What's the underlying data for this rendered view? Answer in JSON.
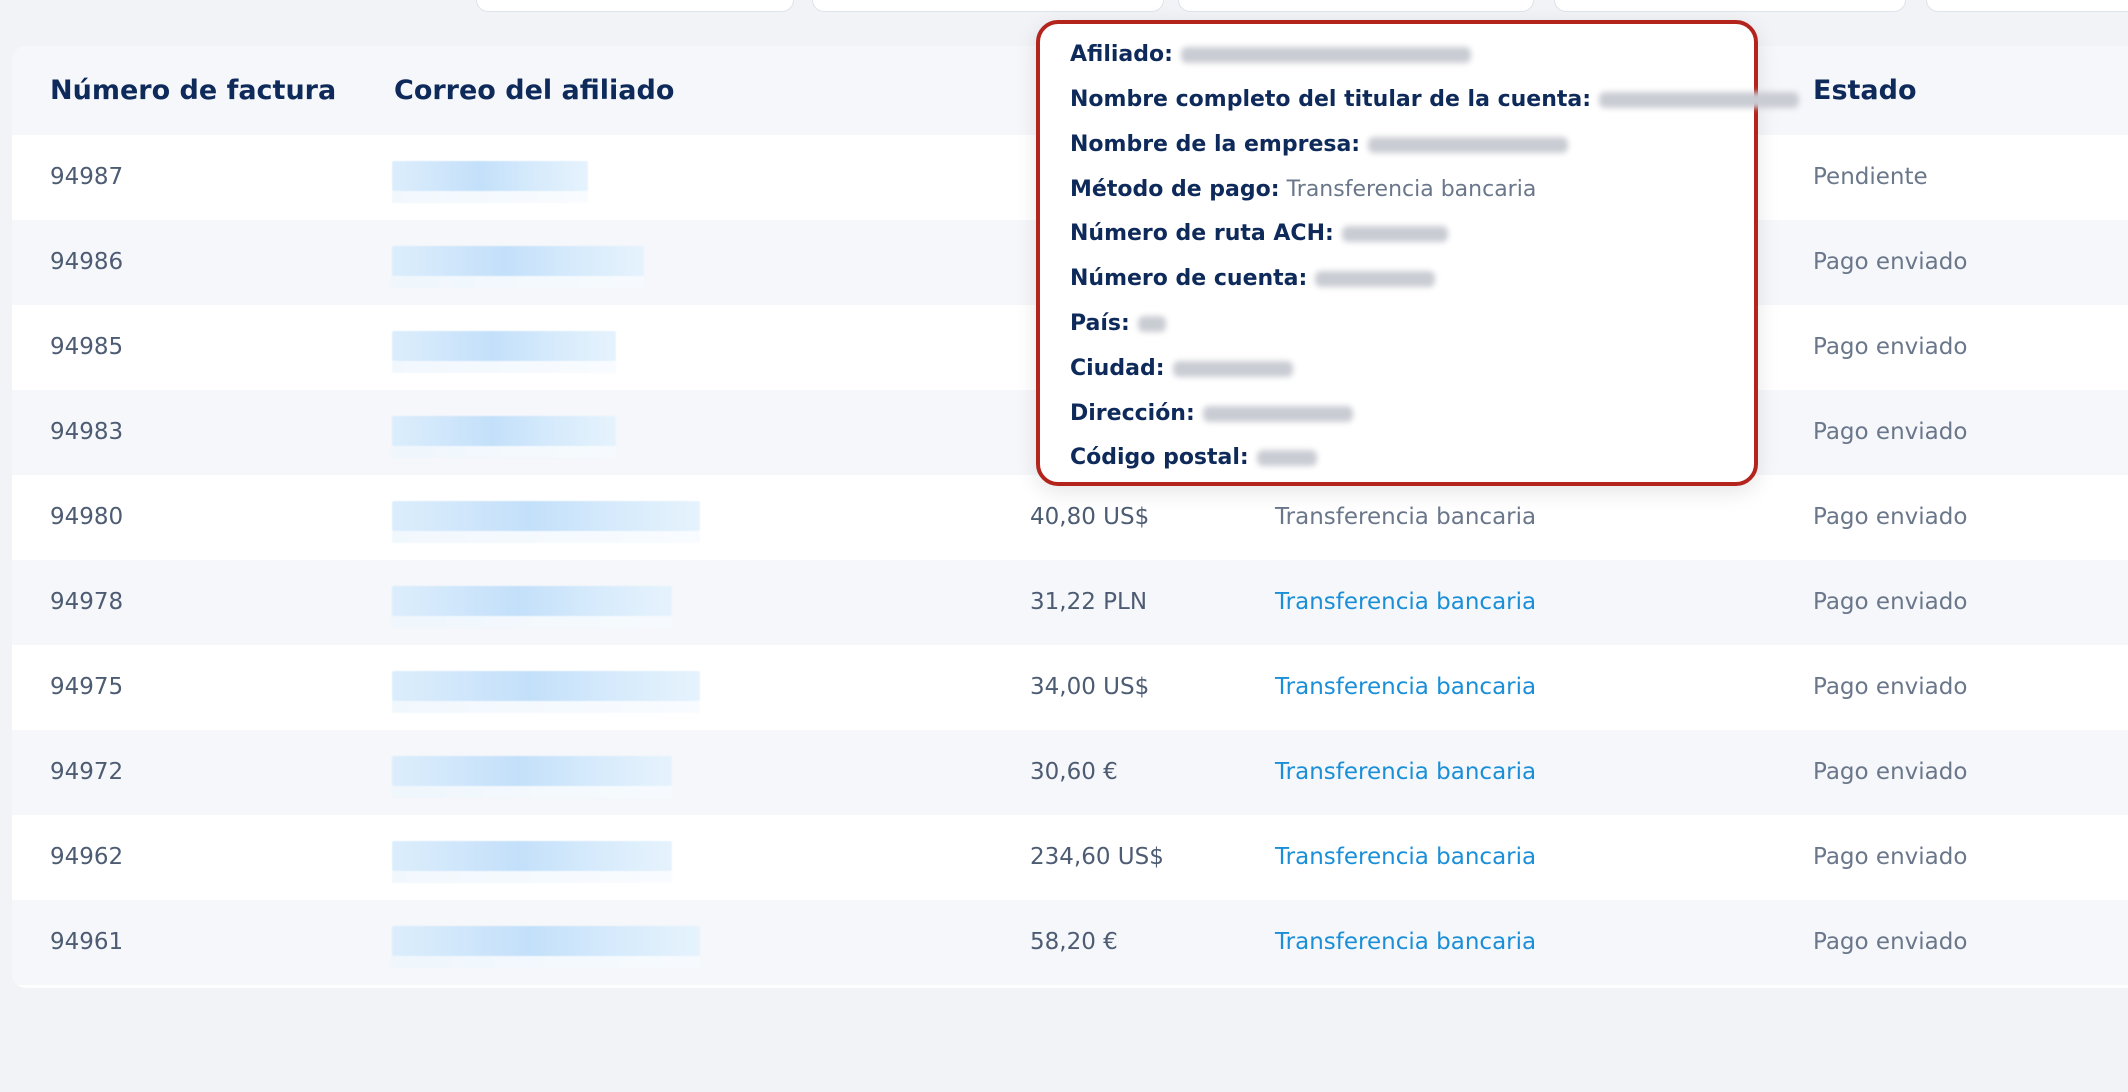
{
  "headers": {
    "invoice": "Número de factura",
    "email": "Correo del afiliado",
    "status": "Estado"
  },
  "rows": [
    {
      "invoice": "94987",
      "amount": "",
      "method": "",
      "status": "Pendiente"
    },
    {
      "invoice": "94986",
      "amount": "",
      "method": "",
      "status": "Pago enviado"
    },
    {
      "invoice": "94985",
      "amount": "",
      "method": "",
      "status": "Pago enviado"
    },
    {
      "invoice": "94983",
      "amount": "",
      "method": "",
      "status": "Pago enviado"
    },
    {
      "invoice": "94980",
      "amount": "40,80 US$",
      "method": "Transferencia bancaria",
      "status": "Pago enviado"
    },
    {
      "invoice": "94978",
      "amount": "31,22 PLN",
      "method": "Transferencia bancaria",
      "status": "Pago enviado"
    },
    {
      "invoice": "94975",
      "amount": "34,00 US$",
      "method": "Transferencia bancaria",
      "status": "Pago enviado"
    },
    {
      "invoice": "94972",
      "amount": "30,60 €",
      "method": "Transferencia bancaria",
      "status": "Pago enviado"
    },
    {
      "invoice": "94962",
      "amount": "234,60 US$",
      "method": "Transferencia bancaria",
      "status": "Pago enviado"
    },
    {
      "invoice": "94961",
      "amount": "58,20 €",
      "method": "Transferencia bancaria",
      "status": "Pago enviado"
    }
  ],
  "popup": {
    "affiliate_label": "Afiliado:",
    "holder_label": "Nombre completo del titular de la cuenta:",
    "company_label": "Nombre de la empresa:",
    "payment_method_label": "Método de pago:",
    "payment_method_value": "Transferencia bancaria",
    "ach_label": "Número de ruta ACH:",
    "account_label": "Número de cuenta:",
    "country_label": "País:",
    "city_label": "Ciudad:",
    "address_label": "Dirección:",
    "postal_label": "Código postal:"
  },
  "colors": {
    "accent_link": "#1a8fd8",
    "header_text": "#0e2a5a",
    "popup_border": "#b3241c"
  }
}
